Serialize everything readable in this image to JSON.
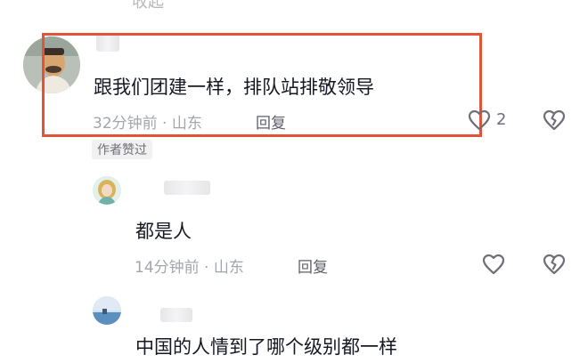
{
  "top_cut_text": "收起",
  "comments": [
    {
      "text": "跟我们团建一样，排队站排敬领导",
      "meta": "32分钟前 · 山东",
      "reply_label": "回复",
      "like_count": "2",
      "author_tag": "作者赞过"
    },
    {
      "text": "都是人",
      "meta": "14分钟前 · 山东",
      "reply_label": "回复"
    },
    {
      "text": "中国的人情到了哪个级别都一样"
    }
  ],
  "colors": {
    "highlight_border": "#e2533a",
    "text_primary": "#161823",
    "text_meta": "#a4a6ad"
  },
  "icons": [
    "heart-outline-icon",
    "broken-heart-icon"
  ]
}
